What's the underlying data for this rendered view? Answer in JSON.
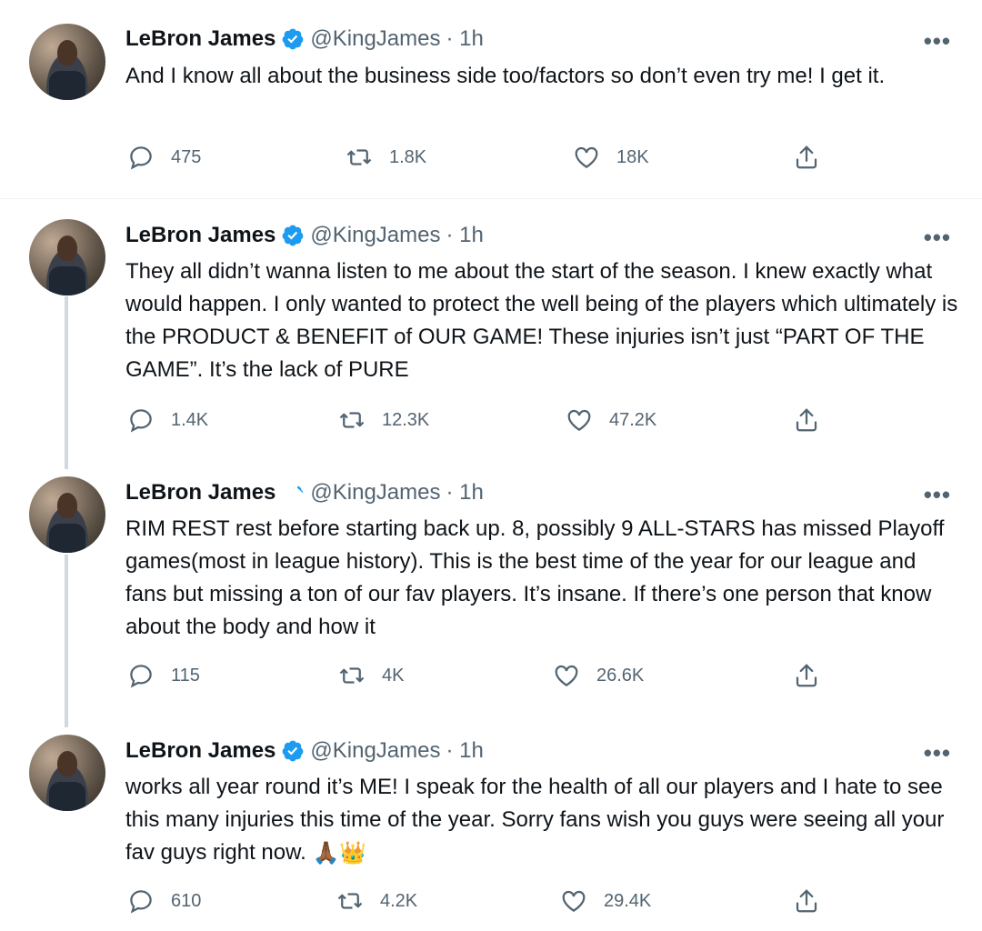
{
  "tweets": [
    {
      "name": "LeBron James",
      "handle": "@KingJames",
      "time": "· 1h",
      "text": "And I know all about the business side too/factors so don’t even try me! I get it.",
      "replies": "475",
      "retweets": "1.8K",
      "likes": "18K"
    },
    {
      "name": "LeBron James",
      "handle": "@KingJames",
      "time": "· 1h",
      "text": "They all didn’t wanna listen to me about the start of the season. I knew exactly what would happen. I only wanted to protect the well being of the players which ultimately is the PRODUCT & BENEFIT of OUR GAME! These injuries isn’t just “PART OF THE GAME”. It’s the lack of PURE",
      "replies": "1.4K",
      "retweets": "12.3K",
      "likes": "47.2K"
    },
    {
      "name": "LeBron James",
      "handle": "@KingJames",
      "time": "· 1h",
      "text": "RIM REST rest before starting back up. 8, possibly 9 ALL-STARS has missed Playoff games(most in league history). This is the best time of the year for our league and fans but missing a ton of our fav players. It’s insane. If there’s one person that know about the body and how it",
      "replies": "115",
      "retweets": "4K",
      "likes": "26.6K"
    },
    {
      "name": "LeBron James",
      "handle": "@KingJames",
      "time": "· 1h",
      "text": "works all year round it’s ME! I speak for the health of all our players and I hate to see this many injuries this time of the year. Sorry fans wish you guys were seeing all your fav guys right now.",
      "emoji": "🙏🏾👑",
      "replies": "610",
      "retweets": "4.2K",
      "likes": "29.4K"
    }
  ],
  "icons": {
    "more": "more-icon",
    "reply": "reply-icon",
    "retweet": "retweet-icon",
    "like": "like-icon",
    "share": "share-icon",
    "verified": "verified-badge-icon"
  },
  "colors": {
    "verified": "#1d9bf0",
    "muted": "#536471",
    "thread": "#cfd9de"
  }
}
